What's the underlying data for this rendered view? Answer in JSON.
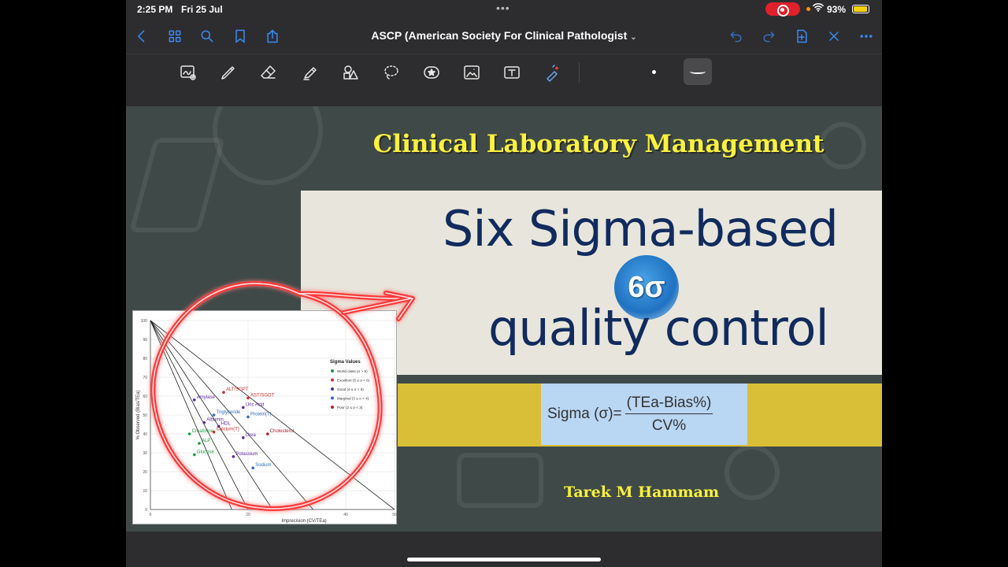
{
  "status_bar": {
    "time": "2:25 PM",
    "date": "Fri 25 Jul",
    "battery": "93%",
    "battery_level": 0.93
  },
  "nav_bar": {
    "title": "ASCP (American Society For Clinical Pathologist",
    "left_icons": [
      "chevron-left-icon",
      "grid-icon",
      "search-icon",
      "bookmark-icon",
      "share-icon"
    ],
    "right_icons": [
      "undo-icon",
      "redo-icon",
      "add-page-icon",
      "close-icon",
      "more-icon"
    ]
  },
  "toolbar": {
    "tools": [
      "lasso-image-icon",
      "pen-icon",
      "eraser-icon",
      "highlighter-icon",
      "shapes-icon",
      "lasso-icon",
      "sticker-icon",
      "image-icon",
      "text-icon",
      "laser-pointer-icon"
    ]
  },
  "slide": {
    "header": "Clinical Laboratory Management",
    "title_line1": "Six Sigma-based",
    "badge": "6σ",
    "title_line2": "quality control",
    "formula_lhs": "Sigma (σ)=",
    "formula_num": "(TEa-Bias%)",
    "formula_den": "CV%",
    "author": "Tarek M Hammam",
    "colors": {
      "header": "#fbf23c",
      "title": "#112b5e",
      "gold": "#d9bf37",
      "formula_bg": "#b9d6f3",
      "annotation": "#e8242a"
    }
  },
  "chart_data": {
    "type": "scatter",
    "xlabel": "Imprecision (CV/TEa)",
    "ylabel": "% Observed (Bias/TEa)",
    "xlim": [
      0,
      50
    ],
    "ylim": [
      0,
      100
    ],
    "x_ticks": [
      0,
      20,
      40,
      50
    ],
    "y_ticks": [
      0,
      10,
      20,
      30,
      40,
      50,
      60,
      70,
      80,
      90,
      100
    ],
    "legend_title": "Sigma Values",
    "legend": [
      {
        "name": "World class (σ > 6)",
        "color": "#1a9a3a"
      },
      {
        "name": "Excellent (5 ≤ σ < 6)",
        "color": "#d03030"
      },
      {
        "name": "Good (4 ≤ σ < 5)",
        "color": "#5a2aa0"
      },
      {
        "name": "Marginal (3 ≤ σ < 4)",
        "color": "#2f6fc0"
      },
      {
        "name": "Poor (2 ≤ σ < 3)",
        "color": "#b02020"
      }
    ],
    "sigma_lines": [
      2,
      3,
      4,
      5,
      6
    ],
    "points": [
      {
        "label": "ALT/SGPT",
        "x": 15,
        "y": 62,
        "color": "#d03030"
      },
      {
        "label": "AST/SGOT",
        "x": 20,
        "y": 59,
        "color": "#d03030"
      },
      {
        "label": "Amylase",
        "x": 9,
        "y": 58,
        "color": "#5a2aa0"
      },
      {
        "label": "Uric Acid",
        "x": 19,
        "y": 54,
        "color": "#5a2aa0"
      },
      {
        "label": "Triglyceride",
        "x": 13,
        "y": 50,
        "color": "#2f6fc0"
      },
      {
        "label": "Protein(T)",
        "x": 20,
        "y": 49,
        "color": "#2f6fc0"
      },
      {
        "label": "Albumin",
        "x": 11,
        "y": 46,
        "color": "#5a2aa0"
      },
      {
        "label": "HDL",
        "x": 14,
        "y": 44,
        "color": "#5a2aa0"
      },
      {
        "label": "Calcium(T)",
        "x": 13,
        "y": 41,
        "color": "#d03030"
      },
      {
        "label": "Creatinine",
        "x": 8,
        "y": 40,
        "color": "#1a9a3a"
      },
      {
        "label": "Urea",
        "x": 19,
        "y": 38,
        "color": "#5a2aa0"
      },
      {
        "label": "Cholesterol",
        "x": 24,
        "y": 40,
        "color": "#b02020"
      },
      {
        "label": "ALP",
        "x": 10,
        "y": 35,
        "color": "#1a9a3a"
      },
      {
        "label": "Glucose",
        "x": 9,
        "y": 29,
        "color": "#1a9a3a"
      },
      {
        "label": "Potassium",
        "x": 17,
        "y": 28,
        "color": "#5a2aa0"
      },
      {
        "label": "Sodium",
        "x": 21,
        "y": 22,
        "color": "#2f6fc0"
      }
    ]
  }
}
